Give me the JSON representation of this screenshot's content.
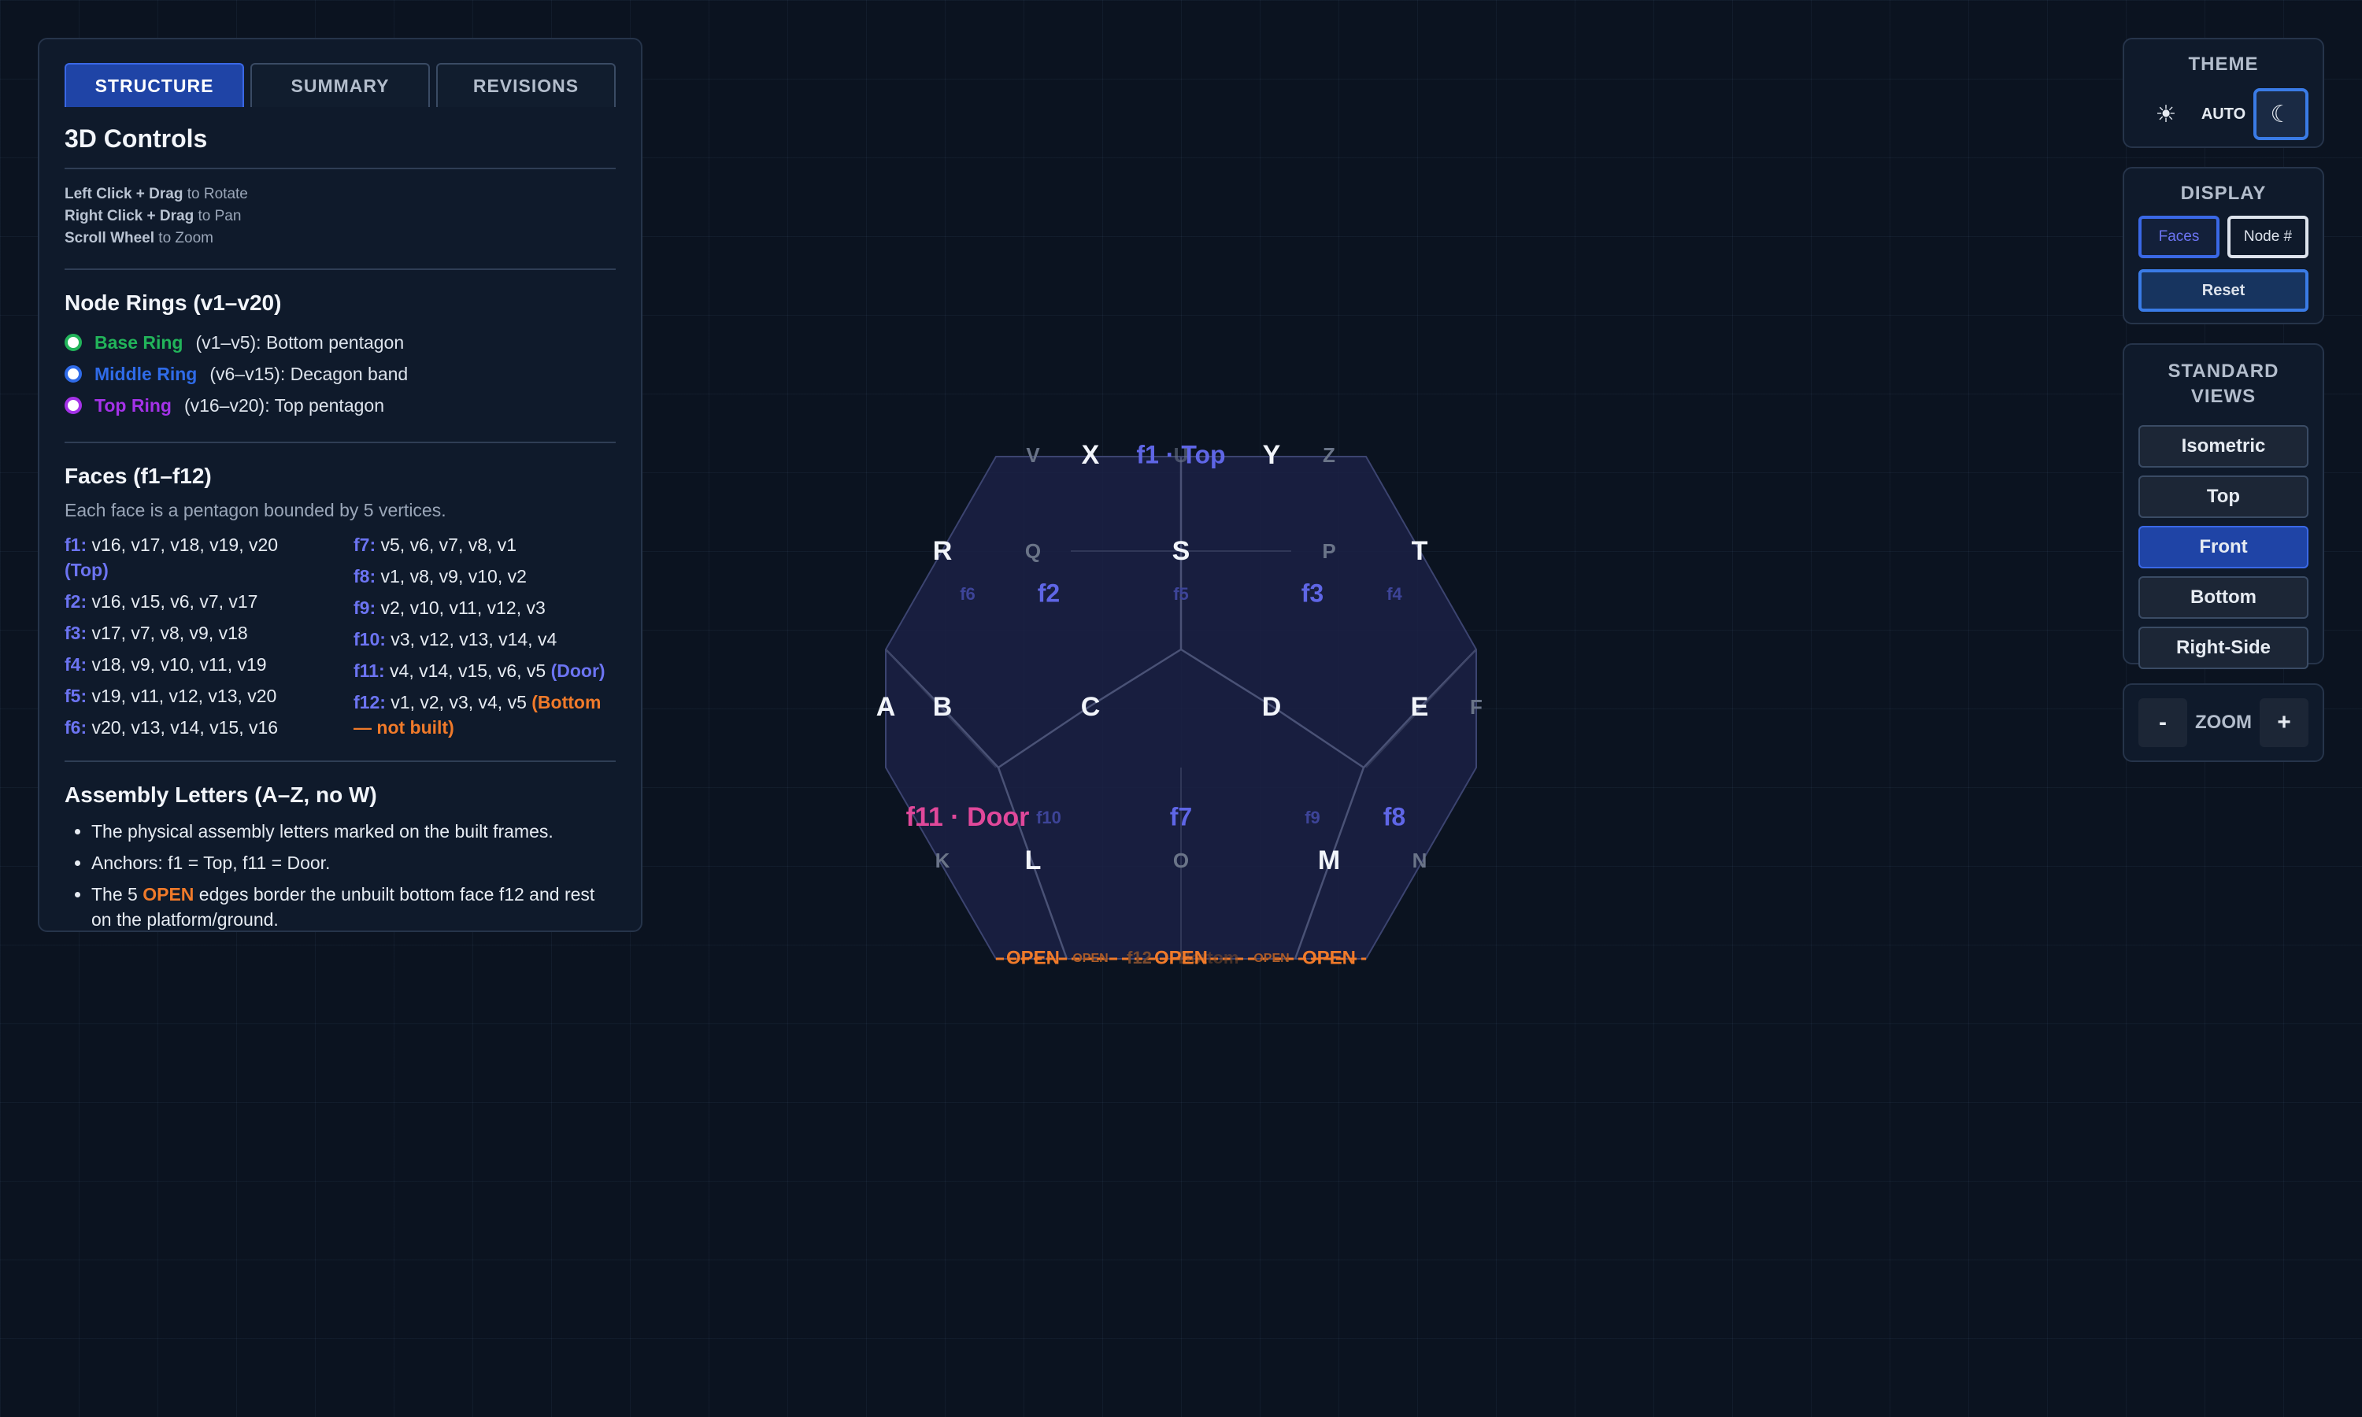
{
  "tabs": [
    "STRUCTURE",
    "SUMMARY",
    "REVISIONS"
  ],
  "controls": {
    "title": "3D Controls",
    "lines": [
      {
        "key": "Left Click + Drag",
        "rest": " to Rotate"
      },
      {
        "key": "Right Click + Drag",
        "rest": " to Pan"
      },
      {
        "key": "Scroll Wheel",
        "rest": " to Zoom"
      }
    ]
  },
  "rings": {
    "title": "Node Rings (v1–v20)",
    "items": [
      {
        "name": "Base Ring",
        "desc": "(v1–v5): Bottom pentagon",
        "color": "#22b45a"
      },
      {
        "name": "Middle Ring",
        "desc": "(v6–v15): Decagon band",
        "color": "#2f6be8"
      },
      {
        "name": "Top Ring",
        "desc": "(v16–v20): Top pentagon",
        "color": "#a432e8"
      }
    ]
  },
  "faces": {
    "title": "Faces (f1–f12)",
    "note": "Each face is a pentagon bounded by 5 vertices.",
    "col1": [
      {
        "k": "f1:",
        "v": " v16, v17, v18, v19, v20",
        "tag": "(Top)"
      },
      {
        "k": "f2:",
        "v": " v16, v15, v6, v7, v17"
      },
      {
        "k": "f3:",
        "v": " v17, v7, v8, v9, v18"
      },
      {
        "k": "f4:",
        "v": " v18, v9, v10, v11, v19"
      },
      {
        "k": "f5:",
        "v": " v19, v11, v12, v13, v20"
      },
      {
        "k": "f6:",
        "v": " v20, v13, v14, v15, v16"
      }
    ],
    "col2": [
      {
        "k": "f7:",
        "v": " v5, v6, v7, v8, v1"
      },
      {
        "k": "f8:",
        "v": " v1, v8, v9, v10, v2"
      },
      {
        "k": "f9:",
        "v": " v2, v10, v11, v12, v3"
      },
      {
        "k": "f10:",
        "v": " v3, v12, v13, v14, v4"
      },
      {
        "k": "f11:",
        "v": " v4, v14, v15, v6, v5",
        "tag": "(Door)"
      },
      {
        "k": "f12:",
        "v": " v1, v2, v3, v4, v5",
        "tag": "(Bottom — not built)"
      }
    ]
  },
  "assembly": {
    "title": "Assembly Letters (A–Z, no W)",
    "b1": "The physical assembly letters marked on the built frames.",
    "b2": "Anchors: f1 = Top, f11 = Door.",
    "b3_pre": "The 5 ",
    "b3_open": "OPEN",
    "b3_post": " edges border the unbuilt bottom face f12 and rest on the platform/ground."
  },
  "theme": {
    "title": "THEME",
    "sun": "☀",
    "auto": "AUTO",
    "moon": "☾"
  },
  "display": {
    "title": "DISPLAY",
    "faces": "Faces",
    "node": "Node #",
    "reset": "Reset"
  },
  "views": {
    "title": "STANDARD VIEWS",
    "items": [
      "Isometric",
      "Top",
      "Front",
      "Bottom",
      "Right-Side"
    ],
    "active": "Front"
  },
  "zoom": {
    "minus": "-",
    "label": "ZOOM",
    "plus": "+"
  },
  "model": {
    "letters_bright": [
      "X",
      "Y",
      "R",
      "S",
      "T",
      "A",
      "B",
      "C",
      "D",
      "E",
      "L",
      "M"
    ],
    "letters_dim": [
      "V",
      "U",
      "Z",
      "Q",
      "P",
      "F",
      "K",
      "O",
      "N"
    ],
    "face_labels": {
      "f1": "f1 · Top",
      "f2": "f2",
      "f3": "f3",
      "f4": "f4",
      "f5": "f5",
      "f6": "f6",
      "f7": "f7",
      "f8": "f8",
      "f9": "f9",
      "f10": "f10",
      "f11": "f11 · Door",
      "f12": "f12"
    },
    "open": "OPEN",
    "bottom_word": "Bottom"
  },
  "colors": {
    "accent": "#6c74f2",
    "door": "#e0489a",
    "open": "#f07a2a",
    "bg": "#0b1320"
  }
}
